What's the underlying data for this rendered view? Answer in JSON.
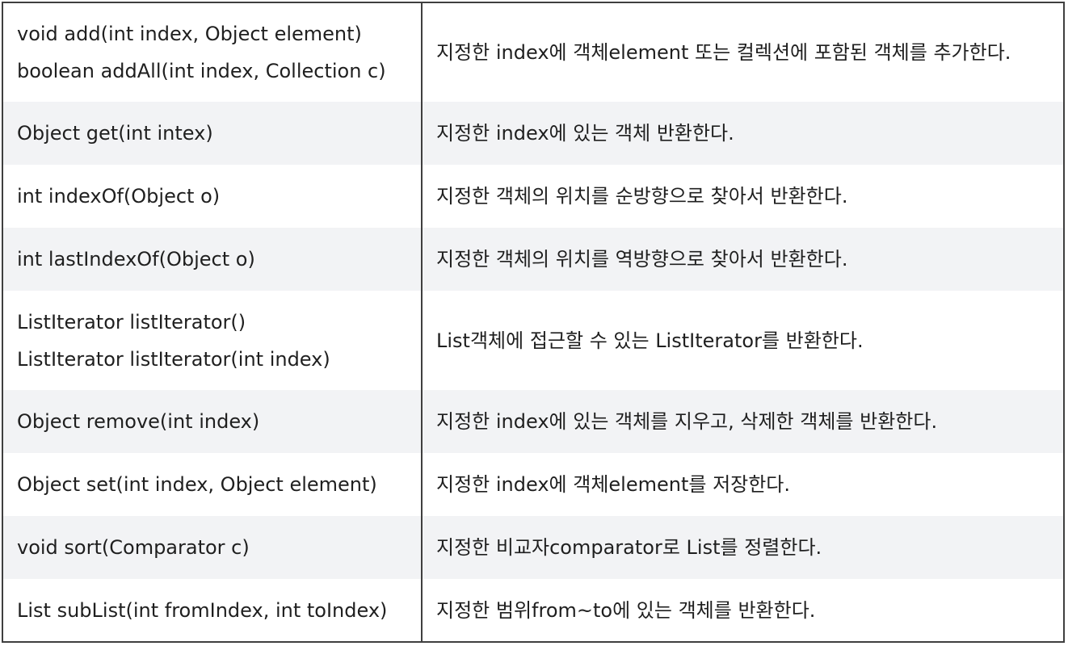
{
  "rows": [
    {
      "method": [
        "void add(int index, Object element)",
        "boolean addAll(int index, Collection c)"
      ],
      "description": "지정한 index에 객체element 또는 컬렉션에 포함된 객체를 추가한다."
    },
    {
      "method": [
        "Object get(int intex)"
      ],
      "description": "지정한 index에 있는 객체 반환한다."
    },
    {
      "method": [
        "int indexOf(Object o)"
      ],
      "description": "지정한 객체의 위치를 순방향으로 찾아서 반환한다."
    },
    {
      "method": [
        "int lastIndexOf(Object o)"
      ],
      "description": "지정한 객체의 위치를 역방향으로 찾아서 반환한다."
    },
    {
      "method": [
        "ListIterator listIterator()",
        "ListIterator listIterator(int index)"
      ],
      "description": "List객체에 접근할 수 있는 ListIterator를 반환한다."
    },
    {
      "method": [
        "Object remove(int index)"
      ],
      "description": "지정한 index에 있는 객체를 지우고, 삭제한 객체를 반환한다."
    },
    {
      "method": [
        "Object set(int index, Object element)"
      ],
      "description": "지정한 index에 객체element를 저장한다."
    },
    {
      "method": [
        "void sort(Comparator c)"
      ],
      "description": "지정한 비교자comparator로 List를 정렬한다."
    },
    {
      "method": [
        "List subList(int fromIndex, int toIndex)"
      ],
      "description": "지정한 범위from~to에 있는 객체를 반환한다."
    }
  ],
  "colors": {
    "border": "#3f3f3f",
    "row_white": "#ffffff",
    "row_gray": "#f2f3f5",
    "text": "#1f1f1f"
  }
}
